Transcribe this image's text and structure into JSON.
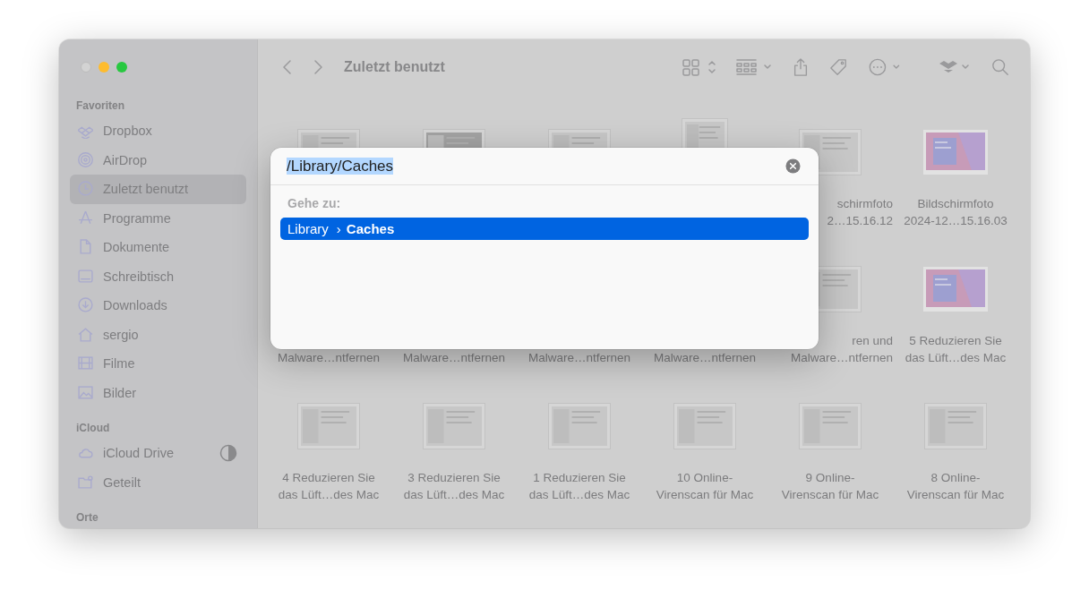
{
  "window": {
    "traffic_lights": [
      {
        "kind": "close",
        "disabled": true
      },
      {
        "kind": "minimize",
        "disabled": false
      },
      {
        "kind": "zoom",
        "disabled": false
      }
    ]
  },
  "sidebar": {
    "sections": [
      {
        "title": "Favoriten",
        "items": [
          {
            "label": "Dropbox",
            "kind": "dropbox",
            "selected": false
          },
          {
            "label": "AirDrop",
            "kind": "airdrop",
            "selected": false
          },
          {
            "label": "Zuletzt benutzt",
            "kind": "clock",
            "selected": true
          },
          {
            "label": "Programme",
            "kind": "apps",
            "selected": false
          },
          {
            "label": "Dokumente",
            "kind": "doc",
            "selected": false
          },
          {
            "label": "Schreibtisch",
            "kind": "desktop",
            "selected": false
          },
          {
            "label": "Downloads",
            "kind": "download",
            "selected": false
          },
          {
            "label": "sergio",
            "kind": "home",
            "selected": false
          },
          {
            "label": "Filme",
            "kind": "film",
            "selected": false
          },
          {
            "label": "Bilder",
            "kind": "photo",
            "selected": false
          }
        ]
      },
      {
        "title": "iCloud",
        "items": [
          {
            "label": "iCloud Drive",
            "kind": "cloud",
            "selected": false
          },
          {
            "label": "Geteilt",
            "kind": "shared",
            "selected": false
          }
        ]
      },
      {
        "title": "Orte"
      }
    ]
  },
  "toolbar": {
    "title": "Zuletzt benutzt"
  },
  "files": [
    {
      "kind": "screenshot"
    },
    {
      "kind": "dark"
    },
    {
      "kind": "screenshot"
    },
    {
      "kind": "tall"
    },
    {
      "kind": "screenshot",
      "covered": true,
      "lines": [
        "schirmfoto",
        "2…15.16.12"
      ]
    },
    {
      "kind": "pink",
      "lines": [
        "Bildschirmfoto",
        "2024-12…15.16.03"
      ]
    },
    {
      "kind": "hidden",
      "lines": [
        "Malware…ntfernen"
      ]
    },
    {
      "kind": "hidden",
      "lines": [
        "Malware…ntfernen"
      ]
    },
    {
      "kind": "hidden",
      "lines": [
        "Malware…ntfernen"
      ]
    },
    {
      "kind": "hidden",
      "lines": [
        "Malware…ntfernen"
      ]
    },
    {
      "kind": "screenshot",
      "covered": true,
      "lines": [
        "ren und",
        "Malware…ntfernen"
      ]
    },
    {
      "kind": "pink",
      "lines": [
        "5 Reduzieren Sie",
        "das Lüft…des Mac"
      ]
    },
    {
      "kind": "screenshot",
      "lines": [
        "4 Reduzieren Sie",
        "das Lüft…des Mac"
      ]
    },
    {
      "kind": "screenshot",
      "lines": [
        "3 Reduzieren Sie",
        "das Lüft…des Mac"
      ]
    },
    {
      "kind": "screenshot",
      "lines": [
        "1 Reduzieren Sie",
        "das Lüft…des Mac"
      ]
    },
    {
      "kind": "screenshot",
      "lines": [
        "10 Online-",
        "Virenscan für Mac"
      ]
    },
    {
      "kind": "screenshot",
      "lines": [
        "9 Online-",
        "Virenscan für Mac"
      ]
    },
    {
      "kind": "screenshot",
      "lines": [
        "8 Online-",
        "Virenscan für Mac"
      ]
    }
  ],
  "dialog": {
    "path": {
      "value": "/Library/Caches",
      "selected": true
    },
    "section_label": "Gehe zu:",
    "results": [
      {
        "segments": [
          "Library",
          "Caches"
        ],
        "separator": "›",
        "selected": true
      }
    ]
  }
}
